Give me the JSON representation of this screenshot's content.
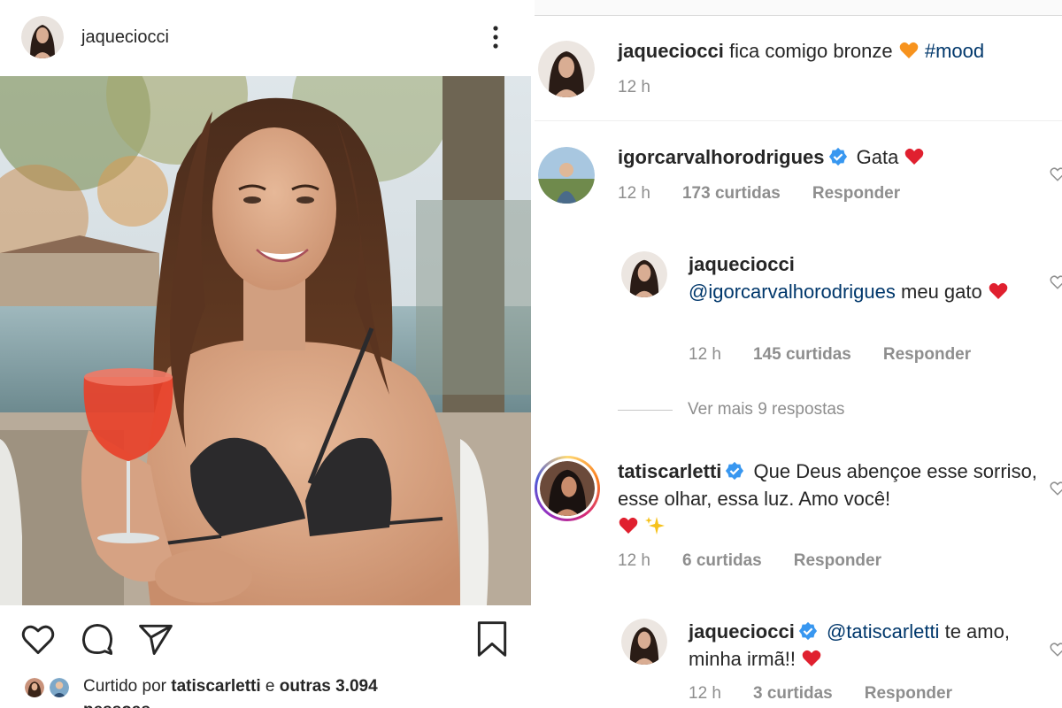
{
  "post": {
    "username": "jaqueciocci",
    "liked_by_prefix": "Curtido por ",
    "liked_by_user": "tatiscarletti",
    "liked_by_middle": " e ",
    "liked_by_others": "outras 3.094",
    "liked_by_suffix": "pessoas"
  },
  "caption": {
    "username": "jaqueciocci",
    "text": "fica comigo bronze",
    "hashtag": "#mood",
    "time": "12 h"
  },
  "comments": [
    {
      "username": "igorcarvalhorodrigues",
      "text": "Gata",
      "time": "12 h",
      "likes": "173 curtidas",
      "reply_label": "Responder"
    },
    {
      "username": "jaqueciocci",
      "mention": "@igorcarvalhorodrigues",
      "text": "meu gato",
      "time": "12 h",
      "likes": "145 curtidas",
      "reply_label": "Responder"
    },
    {
      "username": "tatiscarletti",
      "text": "Que Deus abençoe esse sorriso, esse olhar, essa luz. Amo você!",
      "time": "12 h",
      "likes": "6 curtidas",
      "reply_label": "Responder"
    },
    {
      "username": "jaqueciocci",
      "mention": "@tatiscarletti",
      "text": "te amo, minha irmã!!",
      "time": "12 h",
      "likes": "3 curtidas",
      "reply_label": "Responder"
    }
  ],
  "more_replies": "Ver mais 9 respostas",
  "icons": {
    "more": "more-vertical-icon",
    "like": "heart-outline-icon",
    "comment": "comment-bubble-icon",
    "share": "paper-plane-icon",
    "save": "bookmark-icon",
    "verified": "verified-badge-icon"
  },
  "colors": {
    "verified": "#3897f0",
    "mention": "#00376b",
    "meta": "#8e8e8e",
    "heart": "#ed4956",
    "orange_heart": "#f7931e"
  }
}
